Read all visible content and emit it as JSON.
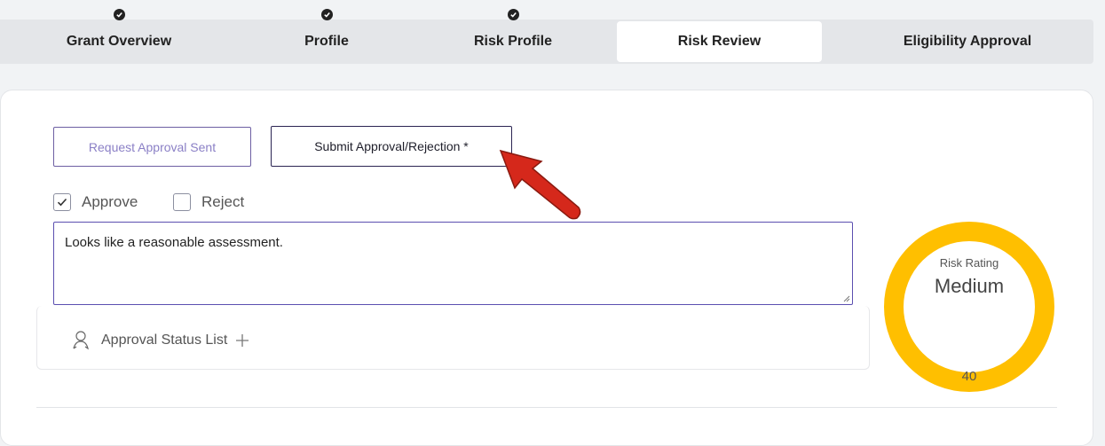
{
  "steps": [
    {
      "label": "Grant Overview",
      "completed": true,
      "active": false
    },
    {
      "label": "Profile",
      "completed": true,
      "active": false
    },
    {
      "label": "Risk Profile",
      "completed": true,
      "active": false
    },
    {
      "label": "Risk Review",
      "completed": false,
      "active": true
    },
    {
      "label": "Eligibility Approval",
      "completed": false,
      "active": false
    }
  ],
  "buttons": {
    "request_sent": "Request Approval Sent",
    "submit": "Submit Approval/Rejection *"
  },
  "decision": {
    "approve_label": "Approve",
    "approve_checked": true,
    "reject_label": "Reject",
    "reject_checked": false
  },
  "comment": "Looks like a reasonable assessment.",
  "approval_status": {
    "label": "Approval Status List",
    "add_icon": "plus-icon",
    "icon": "user-icon"
  },
  "risk": {
    "caption": "Risk Rating",
    "rating": "Medium",
    "score": "40",
    "color": "#ffbf00"
  },
  "colors": {
    "accent": "#5b4fb0",
    "annotation_arrow": "#d5281b"
  }
}
